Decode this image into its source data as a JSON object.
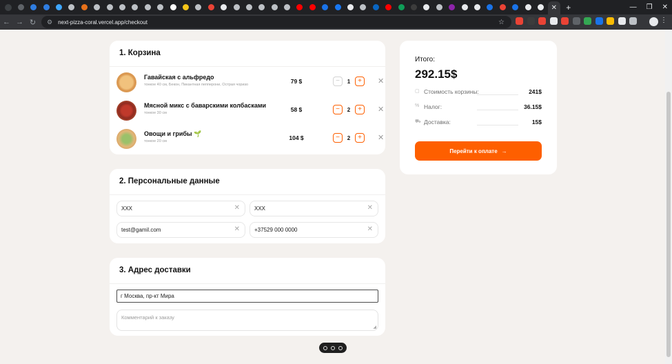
{
  "browser": {
    "url": "next-pizza-coral.vercel.app/checkout",
    "active_tab_close": "✕",
    "new_tab": "+",
    "tab_colors": [
      "#5f6368",
      "#2f7de1",
      "#2f7de1",
      "#3ea6ff",
      "#bdc1c6",
      "#e8711a",
      "#bdc1c6",
      "#bdc1c6",
      "#bdc1c6",
      "#bdc1c6",
      "#bdc1c6",
      "#bdc1c6",
      "#ffffff",
      "#f5c518",
      "#bdc1c6",
      "#ea4335",
      "#e8eaed",
      "#bdc1c6",
      "#bdc1c6",
      "#bdc1c6",
      "#bdc1c6",
      "#bdc1c6",
      "#ff0000",
      "#ff0000",
      "#1a73e8",
      "#1877f2",
      "#e8eaed",
      "#bdc1c6",
      "#0a66c2",
      "#ff0000",
      "#0f9d58",
      "#3c3c3c",
      "#e8eaed",
      "#bdc1c6",
      "#8e24aa",
      "#e8eaed",
      "#e8eaed",
      "#1a73e8",
      "#ea4335",
      "#1a73e8",
      "#e8eaed",
      "#e8eaed"
    ],
    "extension_colors": [
      "#ea4335",
      "#3c3c3c",
      "#ea4335",
      "#e8eaed",
      "#ea4335",
      "#5f6368",
      "#34a853",
      "#1a73e8",
      "#fbbc04",
      "#e8eaed",
      "#bdc1c6"
    ]
  },
  "cart": {
    "title": "1. Корзина",
    "items": [
      {
        "name": "Гавайская с альфредо",
        "desc": "тонкое 40 см, Бекон, Пикантная пепперони, Острая чоризо",
        "price": "79 $",
        "qty": "1"
      },
      {
        "name": "Мясной микс с баварскими колбасками",
        "desc": "тонкое 30 см",
        "price": "58 $",
        "qty": "2"
      },
      {
        "name": "Овощи и грибы 🌱",
        "desc": "тонкое 20 см",
        "price": "104 $",
        "qty": "2"
      }
    ],
    "minus": "−",
    "plus": "+",
    "remove": "✕"
  },
  "personal": {
    "title": "2. Персональные данные",
    "first_name": "XXX",
    "last_name": "XXX",
    "email": "test@gamil.com",
    "phone": "+37529 000 0000",
    "clear": "✕"
  },
  "address": {
    "title": "3. Адрес доставки",
    "value": "г Москва, пр-кт Мира",
    "comment_placeholder": "Комментарий к заказу"
  },
  "summary": {
    "label": "Итого:",
    "total": "292.15$",
    "rows": [
      {
        "icon": "▢",
        "label": "Стоимость корзины:",
        "amount": "241$"
      },
      {
        "icon": "%",
        "label": "Налог:",
        "amount": "36.15$"
      },
      {
        "icon": "⛟",
        "label": "Доставка:",
        "amount": "15$"
      }
    ],
    "button": "Перейти к оплате",
    "button_arrow": "→",
    "accent": "#fe5f00"
  }
}
